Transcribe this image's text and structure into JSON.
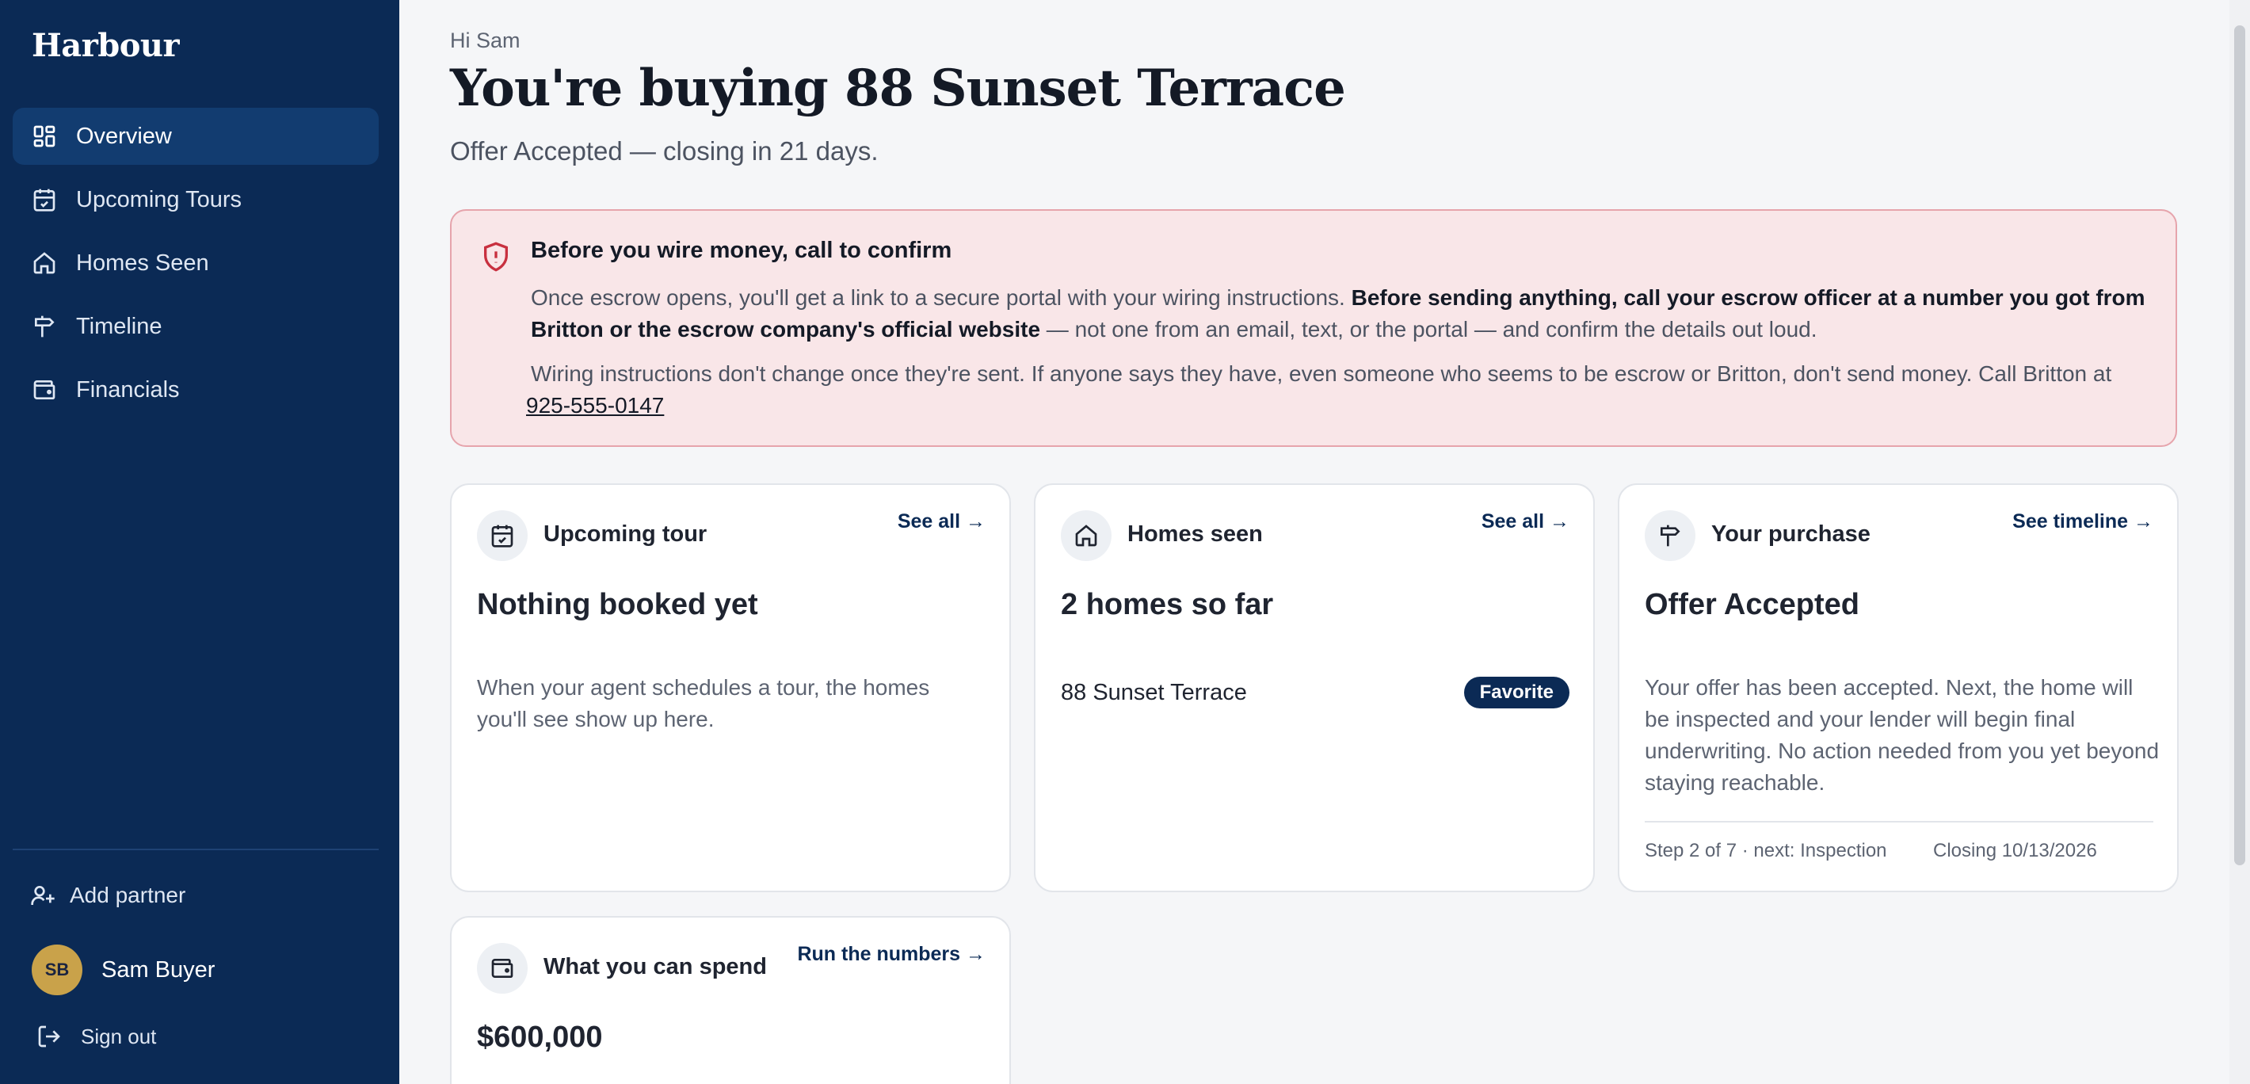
{
  "app": {
    "brand": "Harbour"
  },
  "sidebar": {
    "items": [
      {
        "label": "Overview",
        "icon": "grid-icon",
        "active": true
      },
      {
        "label": "Upcoming Tours",
        "icon": "calendar-check-icon"
      },
      {
        "label": "Homes Seen",
        "icon": "home-icon"
      },
      {
        "label": "Timeline",
        "icon": "signpost-icon"
      },
      {
        "label": "Financials",
        "icon": "wallet-icon"
      }
    ],
    "add_partner": "Add partner",
    "user": {
      "initials": "SB",
      "name": "Sam Buyer"
    },
    "sign_out": "Sign out"
  },
  "header": {
    "greeting": "Hi Sam",
    "title": "You're buying 88 Sunset Terrace",
    "subtitle": "Offer Accepted — closing in 21 days."
  },
  "alert": {
    "title": "Before you wire money, call to confirm",
    "p1_pre": "Once escrow opens, you'll get a link to a secure portal with your wiring instructions. ",
    "p1_bold": "Before sending anything, call your escrow officer at a number you got from Britton or the escrow company's official website",
    "p1_post": " — not one from an email, text, or the portal — and confirm the details out loud.",
    "p2": "Wiring instructions don't change once they're sent. If anyone says they have, even someone who seems to be escrow or Britton, don't send money. Call Britton at ",
    "phone": "925-555-0147"
  },
  "cards": {
    "tour": {
      "label": "Upcoming tour",
      "link": "See all →",
      "headline": "Nothing booked yet",
      "body": "When your agent schedules a tour, the homes you'll see show up here."
    },
    "homes": {
      "label": "Homes seen",
      "link": "See all →",
      "headline": "2 homes so far",
      "address": "88 Sunset Terrace",
      "badge": "Favorite"
    },
    "purchase": {
      "label": "Your purchase",
      "link": "See timeline →",
      "headline": "Offer Accepted",
      "body": "Your offer has been accepted. Next, the home will be inspected and your lender will begin final underwriting. No action needed from you yet beyond staying reachable.",
      "step": "Step 2 of 7 · next: Inspection",
      "closing": "Closing 10/13/2026"
    },
    "spend": {
      "label": "What you can spend",
      "link": "Run the numbers →",
      "headline": "$600,000"
    }
  },
  "colors": {
    "sidebar": "#0b2a55",
    "active": "#123c70",
    "alert_bg": "#f9e6e8",
    "alert_border": "#e6a4ac",
    "badge": "#0b2a55"
  }
}
